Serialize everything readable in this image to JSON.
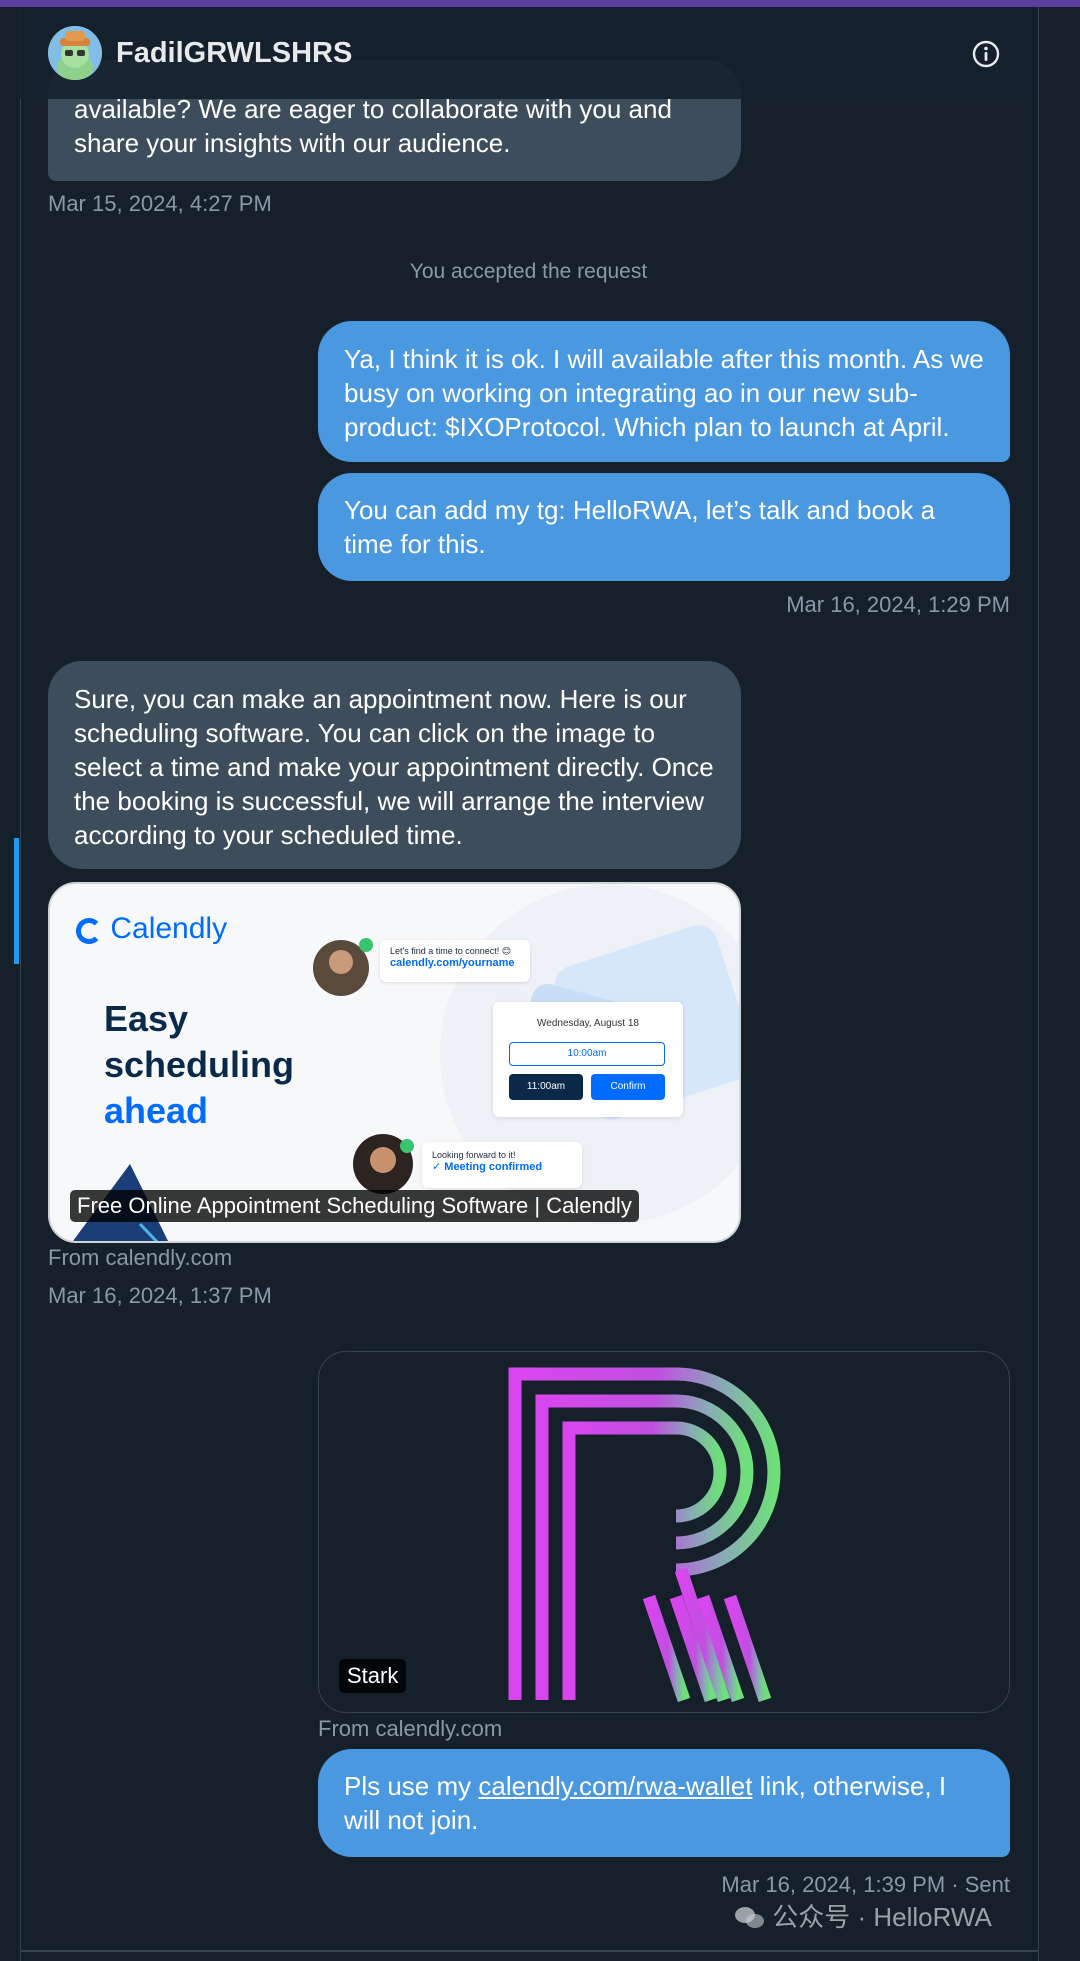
{
  "header": {
    "title": "FadilGRWLSHRS",
    "info_icon": "info-circle-icon",
    "avatar_icon": "cartoon-avatar-icon"
  },
  "messages": {
    "m1": {
      "text": "available? We are eager to collaborate with you and share your insights with our audience.",
      "time": "Mar 15, 2024, 4:27 PM"
    },
    "system": "You accepted the request",
    "m2": "Ya, I think it is ok. I will available after this month. As we busy on working on integrating ao in our new sub-product: $IXOProtocol. Which plan to launch at April.",
    "m3": {
      "text": "You can add my tg: HelloRWA, let’s talk and book a time for this.",
      "time": "Mar 16, 2024, 1:29 PM"
    },
    "m4": "Sure, you can make an appointment now. Here is our scheduling software. You can click on the image to select a time and make your appointment directly. Once the booking is successful, we will arrange the interview according to your scheduled time.",
    "card1": {
      "logo": "Calendly",
      "headline_1": "Easy",
      "headline_2": "scheduling",
      "headline_3": "ahead",
      "bubble_top_1": "Let's find a time to connect! 😊",
      "bubble_top_2": "calendly.com/yourname",
      "date": "Wednesday, August 18",
      "slot1": "10:00am",
      "slot2": "11:00am",
      "confirm": "Confirm",
      "bubble_bottom_1": "Looking forward to it!",
      "bubble_bottom_2": "Meeting confirmed",
      "label": "Free Online Appointment Scheduling Software | Calendly",
      "source": "From calendly.com",
      "time": "Mar 16, 2024, 1:37 PM"
    },
    "card2": {
      "label": "Stark",
      "source": "From calendly.com",
      "image_icon": "r-logo-icon"
    },
    "m5": {
      "text_before": "Pls use my ",
      "link": "calendly.com/rwa-wallet",
      "text_after": " link, otherwise, I will not join.",
      "time": "Mar 16, 2024, 1:39 PM · Sent"
    }
  },
  "watermark": "公众号 · HelloRWA",
  "colors": {
    "background": "#15202b",
    "incoming": "#3d4d5c",
    "outgoing": "#4a98e0",
    "accent": "#1d9bf0"
  }
}
